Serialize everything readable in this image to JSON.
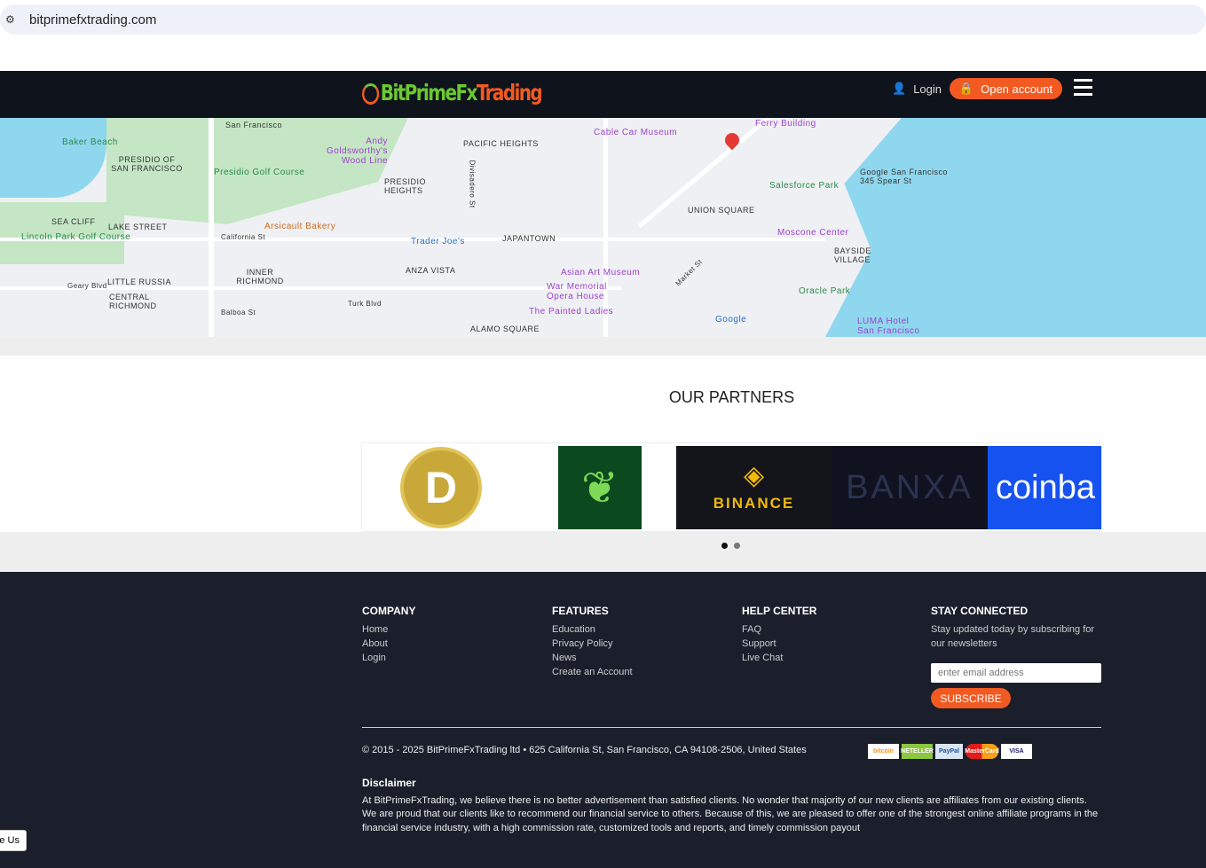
{
  "browser": {
    "url": "bitprimefxtrading.com",
    "icon": "site-settings-icon"
  },
  "nav": {
    "logo_green": "BitPrimeFx",
    "logo_orange": "Trading",
    "login": "Login",
    "open_account": "Open account",
    "colors": {
      "bg": "#0e131c",
      "accent": "#f25a22",
      "logo_green": "#6bc832"
    }
  },
  "map": {
    "labels": [
      "San Francisco",
      "Baker Beach",
      "Andy Goldsworthy's Wood Line",
      "PRESIDIO OF SAN FRANCISCO",
      "Presidio Golf Course",
      "PACIFIC HEIGHTS",
      "PRESIDIO HEIGHTS",
      "Cable Car Museum",
      "Ferry Building",
      "Google San Francisco 345 Spear St",
      "Salesforce Park",
      "UNION SQUARE",
      "SEA CLIFF",
      "LAKE STREET",
      "Lincoln Park Golf Course",
      "Arsicault Bakery",
      "Trader Joe's",
      "JAPANTOWN",
      "Moscone Center",
      "BAYSIDE VILLAGE",
      "INNER RICHMOND",
      "ANZA VISTA",
      "LITTLE RUSSIA",
      "Asian Art Museum",
      "War Memorial Opera House",
      "Oracle Park",
      "CENTRAL RICHMOND",
      "The Painted Ladies",
      "ALAMO SQUARE",
      "LUMA Hotel San Francisco",
      "Google",
      "California St",
      "Geary Blvd",
      "Balboa St",
      "Turk Blvd",
      "Divisadero St",
      "Market St"
    ]
  },
  "partners": {
    "title": "OUR PARTNERS",
    "logos": [
      "Dogecoin",
      "Robinhood",
      "BINANCE",
      "BANXA",
      "coinbase"
    ],
    "visible_text": [
      "D",
      "BINANCE",
      "BANXA",
      "coinba"
    ],
    "active_page": 1,
    "pages": 2
  },
  "footer": {
    "company": {
      "title": "COMPANY",
      "links": [
        "Home",
        "About",
        "Login"
      ]
    },
    "features": {
      "title": "FEATURES",
      "links": [
        "Education",
        "Privacy Policy",
        "News",
        "Create an Account"
      ]
    },
    "help": {
      "title": "HELP CENTER",
      "links": [
        "FAQ",
        "Support",
        "Live Chat"
      ]
    },
    "stay": {
      "title": "STAY CONNECTED",
      "text": "Stay updated today by subscribing for our newsletters",
      "placeholder": "enter email address",
      "button": "SUBSCRIBE"
    },
    "copyright": "© 2015 - 2025 BitPrimeFxTrading ltd • 625 California St, San Francisco, CA 94108-2506, United States",
    "payments": [
      "bitcoin",
      "NETELLER",
      "PayPal",
      "MasterCard",
      "VISA"
    ],
    "disclaimer_title": "Disclaimer",
    "disclaimer": "At BitPrimeFxTrading, we believe there is no better advertisement than satisfied clients. No wonder that majority of our new clients are affiliates from our existing clients. We are proud that our clients like to recommend our financial service to others. Because of this, we are pleased to offer one of the strongest online affiliate programs in the financial service industry, with a high commission rate, customized tools and reports, and timely commission payout"
  },
  "like_us": "e Us"
}
